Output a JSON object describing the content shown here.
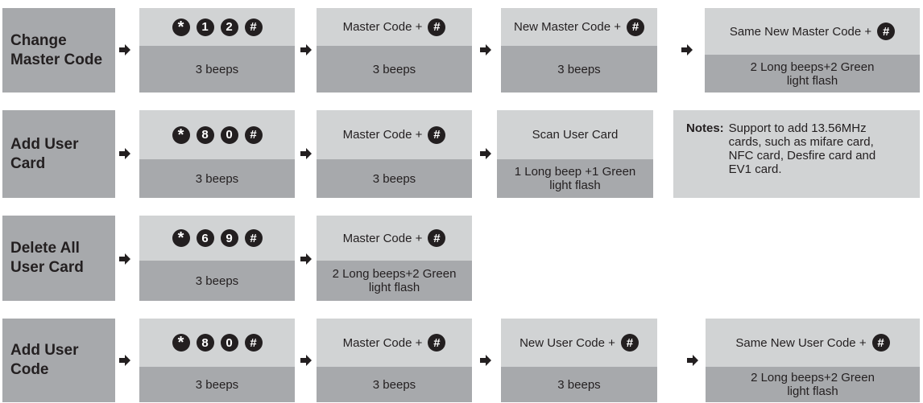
{
  "colors": {
    "dark": "#231f20",
    "mid": "#a7a9ac",
    "light": "#d1d3d4"
  },
  "rows": [
    {
      "label": "Change\nMaster Code",
      "steps": [
        {
          "keys": [
            "*",
            "1",
            "2",
            "#"
          ],
          "result": "3 beeps"
        },
        {
          "text": "Master Code +",
          "hash": "#",
          "result": "3 beeps"
        },
        {
          "text": "New Master Code +",
          "hash": "#",
          "result": "3 beeps"
        },
        {
          "text": "Same New Master Code +",
          "hash": "#",
          "result": "2 Long beeps+2 Green\nlight flash"
        }
      ]
    },
    {
      "label": "Add User\nCard",
      "steps": [
        {
          "keys": [
            "*",
            "8",
            "0",
            "#"
          ],
          "result": "3 beeps"
        },
        {
          "text": "Master Code +",
          "hash": "#",
          "result": "3 beeps"
        },
        {
          "text": "Scan User Card",
          "result": "1 Long beep +1 Green\nlight flash"
        }
      ],
      "notes": {
        "label": "Notes:",
        "text": "Support to add 13.56MHz\ncards, such as mifare card,\nNFC card, Desfire card and\nEV1 card."
      }
    },
    {
      "label": "Delete All\nUser Card",
      "steps": [
        {
          "keys": [
            "*",
            "6",
            "9",
            "#"
          ],
          "result": "3 beeps"
        },
        {
          "text": "Master Code +",
          "hash": "#",
          "result": "2 Long beeps+2 Green\nlight flash"
        }
      ]
    },
    {
      "label": "Add User\nCode",
      "steps": [
        {
          "keys": [
            "*",
            "8",
            "0",
            "#"
          ],
          "result": "3 beeps"
        },
        {
          "text": "Master Code +",
          "hash": "#",
          "result": "3 beeps"
        },
        {
          "text": "New User Code +",
          "hash": "#",
          "result": "3 beeps"
        },
        {
          "text": "Same New User Code +",
          "hash": "#",
          "result": "2 Long beeps+2 Green\nlight flash"
        }
      ]
    }
  ]
}
